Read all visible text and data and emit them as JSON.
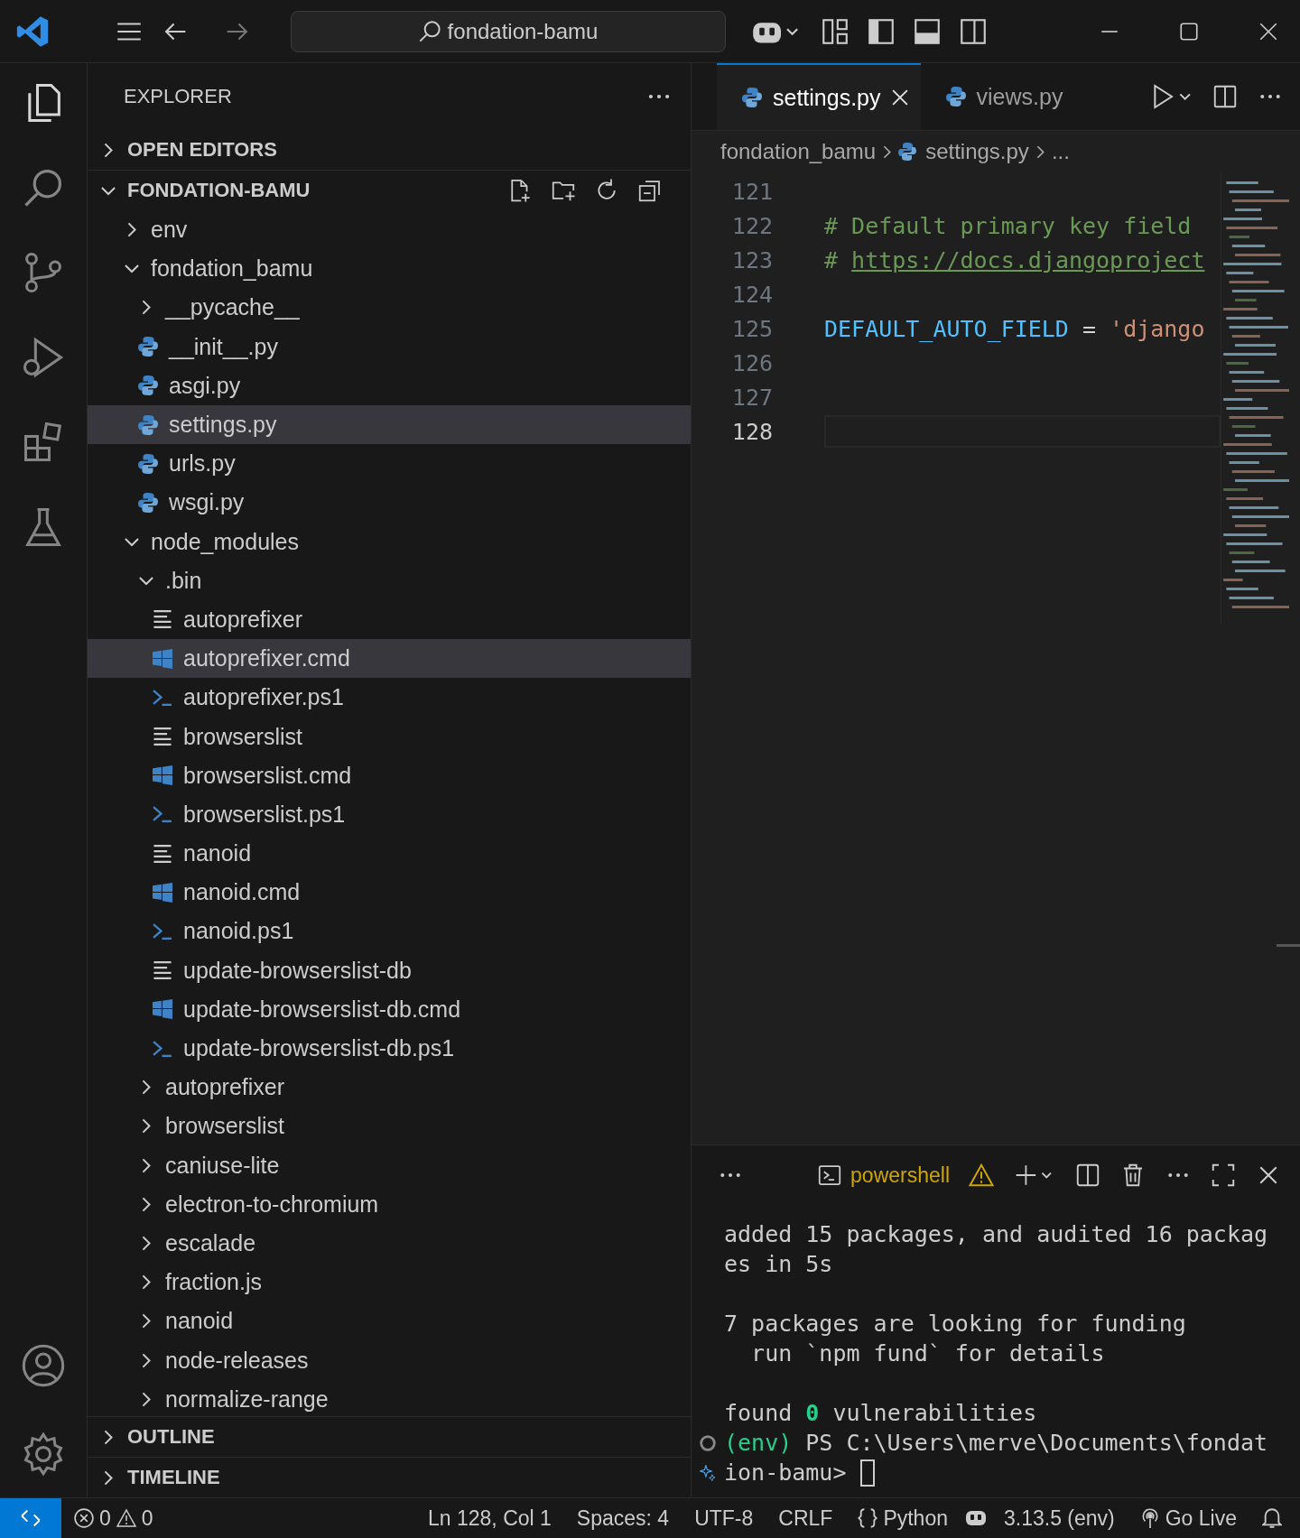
{
  "title_bar": {
    "search": "fondation-bamu"
  },
  "sidebar": {
    "title": "EXPLORER",
    "sections": [
      {
        "label": "OPEN EDITORS",
        "expanded": false
      },
      {
        "label": "FONDATION-BAMU",
        "expanded": true
      }
    ],
    "tree": [
      {
        "label": "env",
        "kind": "folder",
        "expanded": false,
        "selected": false
      },
      {
        "label": "fondation_bamu",
        "kind": "folder",
        "expanded": true,
        "selected": false,
        "children": [
          {
            "label": "__pycache__",
            "kind": "folder",
            "expanded": false,
            "selected": false
          },
          {
            "label": "__init__.py",
            "kind": "python",
            "selected": false
          },
          {
            "label": "asgi.py",
            "kind": "python",
            "selected": false
          },
          {
            "label": "settings.py",
            "kind": "python",
            "selected": true
          },
          {
            "label": "urls.py",
            "kind": "python",
            "selected": false
          },
          {
            "label": "wsgi.py",
            "kind": "python",
            "selected": false
          }
        ]
      },
      {
        "label": "node_modules",
        "kind": "folder",
        "expanded": true,
        "selected": false,
        "children": [
          {
            "label": ".bin",
            "kind": "folder",
            "expanded": true,
            "selected": false,
            "children": [
              {
                "label": "autoprefixer",
                "kind": "text",
                "selected": false
              },
              {
                "label": "autoprefixer.cmd",
                "kind": "cmd",
                "selected": true
              },
              {
                "label": "autoprefixer.ps1",
                "kind": "ps1",
                "selected": false
              },
              {
                "label": "browserslist",
                "kind": "text",
                "selected": false
              },
              {
                "label": "browserslist.cmd",
                "kind": "cmd",
                "selected": false
              },
              {
                "label": "browserslist.ps1",
                "kind": "ps1",
                "selected": false
              },
              {
                "label": "nanoid",
                "kind": "text",
                "selected": false
              },
              {
                "label": "nanoid.cmd",
                "kind": "cmd",
                "selected": false
              },
              {
                "label": "nanoid.ps1",
                "kind": "ps1",
                "selected": false
              },
              {
                "label": "update-browserslist-db",
                "kind": "text",
                "selected": false
              },
              {
                "label": "update-browserslist-db.cmd",
                "kind": "cmd",
                "selected": false
              },
              {
                "label": "update-browserslist-db.ps1",
                "kind": "ps1",
                "selected": false
              }
            ]
          },
          {
            "label": "autoprefixer",
            "kind": "folder",
            "expanded": false,
            "selected": false
          },
          {
            "label": "browserslist",
            "kind": "folder",
            "expanded": false,
            "selected": false
          },
          {
            "label": "caniuse-lite",
            "kind": "folder",
            "expanded": false,
            "selected": false
          },
          {
            "label": "electron-to-chromium",
            "kind": "folder",
            "expanded": false,
            "selected": false
          },
          {
            "label": "escalade",
            "kind": "folder",
            "expanded": false,
            "selected": false
          },
          {
            "label": "fraction.js",
            "kind": "folder",
            "expanded": false,
            "selected": false
          },
          {
            "label": "nanoid",
            "kind": "folder",
            "expanded": false,
            "selected": false
          },
          {
            "label": "node-releases",
            "kind": "folder",
            "expanded": false,
            "selected": false
          },
          {
            "label": "normalize-range",
            "kind": "folder",
            "expanded": false,
            "selected": false
          }
        ]
      }
    ],
    "panels": [
      {
        "label": "OUTLINE",
        "expanded": false
      },
      {
        "label": "TIMELINE",
        "expanded": false
      }
    ]
  },
  "editor": {
    "tabs": [
      {
        "label": "settings.py",
        "selected": true
      },
      {
        "label": "views.py",
        "selected": false
      }
    ],
    "breadcrumbs": [
      "fondation_bamu",
      "settings.py",
      "..."
    ],
    "lines": [
      {
        "number": "121",
        "current": false
      },
      {
        "number": "122",
        "current": false,
        "tokens": [
          {
            "text": "# Default primary key field",
            "kind": "comment"
          }
        ]
      },
      {
        "number": "123",
        "current": false,
        "tokens": [
          {
            "text": "# ",
            "kind": "comment"
          },
          {
            "text": "https://docs.djangoproject",
            "kind": "link"
          }
        ]
      },
      {
        "number": "124",
        "current": false
      },
      {
        "number": "125",
        "current": false,
        "tokens": [
          {
            "text": "DEFAULT_AUTO_FIELD",
            "kind": "variable"
          },
          {
            "text": " = ",
            "kind": "operator"
          },
          {
            "text": "'django",
            "kind": "string"
          }
        ]
      },
      {
        "number": "126",
        "current": false
      },
      {
        "number": "127",
        "current": false
      },
      {
        "number": "128",
        "current": true
      }
    ]
  },
  "terminal": {
    "shell": "powershell",
    "warning": true,
    "lines": [
      {
        "kind": "output",
        "segments": [
          {
            "text": "added 15 packages, and audited 16 packag",
            "kind": "plain"
          }
        ]
      },
      {
        "kind": "output",
        "segments": [
          {
            "text": "es in 5s",
            "kind": "plain"
          }
        ]
      },
      {
        "kind": "output"
      },
      {
        "kind": "output",
        "segments": [
          {
            "text": "7 packages are looking for funding",
            "kind": "plain"
          }
        ]
      },
      {
        "kind": "output",
        "segments": [
          {
            "text": "  run `npm fund` for details",
            "kind": "plain"
          }
        ]
      },
      {
        "kind": "output"
      },
      {
        "kind": "output",
        "segments": [
          {
            "text": "found ",
            "kind": "plain"
          },
          {
            "text": "0",
            "kind": "success"
          },
          {
            "text": " vulnerabilities",
            "kind": "plain"
          }
        ]
      },
      {
        "kind": "command",
        "segments": [
          {
            "text": "(env)",
            "kind": "env"
          },
          {
            "text": " PS C:\\Users\\merve\\Documents\\fondat",
            "kind": "plain"
          }
        ]
      },
      {
        "kind": "input",
        "segments": [
          {
            "text": "ion-bamu> ",
            "kind": "plain"
          }
        ]
      }
    ]
  },
  "status_bar": {
    "errors": "0",
    "warnings": "0",
    "position": "Ln 128, Col 1",
    "spaces": "Spaces: 4",
    "encoding": "UTF-8",
    "eol": "CRLF",
    "language": "Python",
    "interpreter": "3.13.5 (env)",
    "live": "Go Live"
  }
}
